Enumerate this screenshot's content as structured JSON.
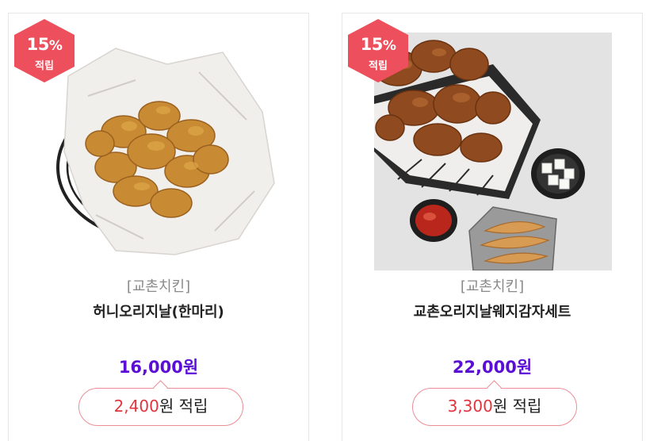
{
  "colors": {
    "badge": "#ee4f5c",
    "price": "#5b0fd6",
    "points_amount": "#e0353f",
    "pill_border": "#ec8e95"
  },
  "products": [
    {
      "badge_percent": "15",
      "badge_sign": "%",
      "badge_label": "적립",
      "image_icon": "fried-chicken-basket-image",
      "brand": "[교촌치킨]",
      "name": "허니오리지날(한마리)",
      "price": "16,000원",
      "points_amount": "2,400",
      "points_suffix": "원 적립"
    },
    {
      "badge_percent": "15",
      "badge_sign": "%",
      "badge_label": "적립",
      "image_icon": "chicken-wedge-set-image",
      "brand": "[교촌치킨]",
      "name": "교촌오리지날웨지감자세트",
      "price": "22,000원",
      "points_amount": "3,300",
      "points_suffix": "원 적립"
    }
  ]
}
